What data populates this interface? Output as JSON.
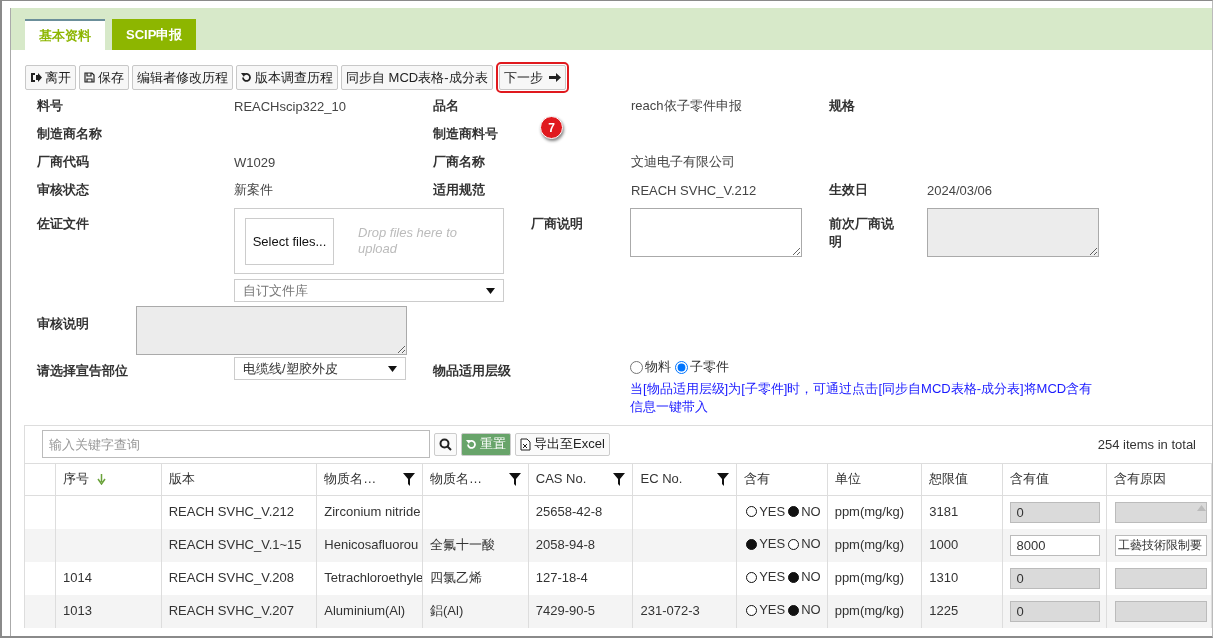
{
  "tabs": [
    {
      "label": "基本资料",
      "selected": true
    },
    {
      "label": "SCIP申报",
      "selected": false
    }
  ],
  "toolbar": [
    {
      "label": "离开",
      "kind": "exit",
      "highlighted": false
    },
    {
      "label": "保存",
      "kind": "save",
      "highlighted": false
    },
    {
      "label": "编辑者修改历程",
      "kind": "plain",
      "highlighted": false
    },
    {
      "label": "版本调查历程",
      "kind": "history",
      "highlighted": false
    },
    {
      "label": "同步自 MCD表格-成分表",
      "kind": "plain",
      "highlighted": false
    },
    {
      "label": "下一步",
      "kind": "next",
      "highlighted": true
    }
  ],
  "step_marker": "7",
  "info_rows": [
    [
      {
        "label": "料号",
        "value": "REACHscip322_10"
      },
      {
        "label": "品名",
        "value": "reach依子零件申报"
      },
      {
        "label": "规格"
      }
    ],
    [
      {
        "label": "制造商名称"
      },
      {
        "label": "制造商料号"
      }
    ],
    [
      {
        "label": "厂商代码",
        "value": "W1029"
      },
      {
        "label": "厂商名称",
        "value": "文迪电子有限公司"
      }
    ],
    [
      {
        "label": "审核状态",
        "value": "新案件"
      },
      {
        "label": "适用规范",
        "value": "REACH SVHC_V.212"
      },
      {
        "label": "生效日",
        "value": "2024/03/06"
      }
    ]
  ],
  "attachments": {
    "label": "佐证文件",
    "select_button": "Select files...",
    "drop_hint": "Drop files here to upload",
    "library": "自订文件库"
  },
  "vendor_note": {
    "label": "厂商说明",
    "disabled": false
  },
  "previous_note": {
    "label": "前次厂商说明",
    "disabled": true
  },
  "review_note": {
    "label": "审核说明",
    "disabled": true
  },
  "declare_part": {
    "label": "请选择宣告部位",
    "value": "电缆线/塑胶外皮"
  },
  "level": {
    "label": "物品适用层级",
    "options": [
      {
        "label": "物料",
        "selected": false
      },
      {
        "label": "子零件",
        "selected": true
      }
    ],
    "hint": "当[物品适用层级]为[子零件]时，可通过点击[同步自MCD表格-成分表]将MCD含有信息一键带入"
  },
  "grid": {
    "search_placeholder": "输入关键字查询",
    "reset": "重置",
    "export": "导出至Excel",
    "total": "254 items in total",
    "columns": [
      {
        "label": "序号",
        "filter": false,
        "sorted": true
      },
      {
        "label": "版本",
        "filter": false,
        "sorted": false
      },
      {
        "label": "物质名…",
        "filter": true,
        "sorted": false
      },
      {
        "label": "物质名…",
        "filter": true,
        "sorted": false
      },
      {
        "label": "CAS No.",
        "filter": true,
        "sorted": false
      },
      {
        "label": "EC No.",
        "filter": true,
        "sorted": false
      },
      {
        "label": "含有",
        "filter": false,
        "sorted": false
      },
      {
        "label": "单位",
        "filter": false,
        "sorted": false
      },
      {
        "label": "恕限值",
        "filter": false,
        "sorted": false
      },
      {
        "label": "含有值",
        "filter": false,
        "sorted": false
      },
      {
        "label": "含有原因",
        "filter": false,
        "sorted": false
      }
    ],
    "rows": [
      {
        "no": "",
        "version": "REACH SVHC_V.212",
        "name_en": "Zirconium nitride",
        "name_zh": "",
        "cas": "25658-42-8",
        "ec": "",
        "yes_label": "YES",
        "no_label": "NO",
        "contains": false,
        "unit": "ppm(mg/kg)",
        "limit": "3181",
        "amount": "0",
        "reason": "",
        "editable": false
      },
      {
        "no": "",
        "version": "REACH SVHC_V.1~15",
        "name_en": "Henicosafluorou",
        "name_zh": "全氟十一酸",
        "cas": "2058-94-8",
        "ec": "",
        "yes_label": "YES",
        "no_label": "NO",
        "contains": true,
        "unit": "ppm(mg/kg)",
        "limit": "1000",
        "amount": "8000",
        "reason": "工藝技術限制要",
        "editable": true
      },
      {
        "no": "1014",
        "version": "REACH SVHC_V.208",
        "name_en": "Tetrachloroethyle",
        "name_zh": "四氯乙烯",
        "cas": "127-18-4",
        "ec": "",
        "yes_label": "YES",
        "no_label": "NO",
        "contains": false,
        "unit": "ppm(mg/kg)",
        "limit": "1310",
        "amount": "0",
        "reason": "",
        "editable": false
      },
      {
        "no": "1013",
        "version": "REACH SVHC_V.207",
        "name_en": "Aluminium(Al)",
        "name_zh": "鋁(Al)",
        "cas": "7429-90-5",
        "ec": "231-072-3",
        "yes_label": "YES",
        "no_label": "NO",
        "contains": false,
        "unit": "ppm(mg/kg)",
        "limit": "1225",
        "amount": "0",
        "reason": "",
        "editable": false
      }
    ]
  }
}
